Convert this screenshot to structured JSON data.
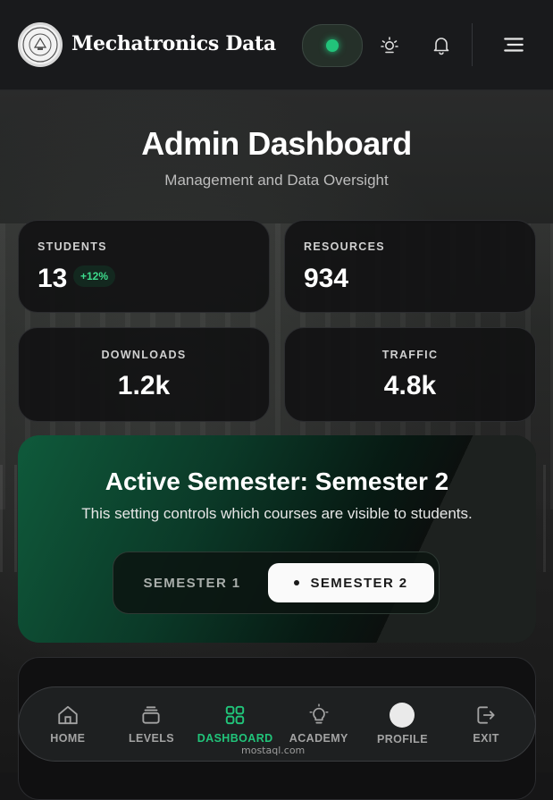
{
  "header": {
    "brand": "Mechatronics Data",
    "icons": [
      "globe-icon",
      "sun-icon",
      "bell-icon",
      "menu-icon"
    ]
  },
  "page": {
    "title": "Admin Dashboard",
    "subtitle": "Management and Data Oversight"
  },
  "stats": [
    {
      "label": "STUDENTS",
      "value": "13",
      "trend": "+12%"
    },
    {
      "label": "RESOURCES",
      "value": "934"
    },
    {
      "label": "DOWNLOADS",
      "value": "1.2k"
    },
    {
      "label": "TRAFFIC",
      "value": "4.8k"
    }
  ],
  "semester": {
    "title": "Active Semester: Semester 2",
    "description": "This setting controls which courses are visible to students.",
    "options": [
      "SEMESTER 1",
      "SEMESTER 2"
    ],
    "selected": "SEMESTER 2"
  },
  "nav": {
    "items": [
      {
        "label": "HOME",
        "icon": "home-icon"
      },
      {
        "label": "LEVELS",
        "icon": "layers-icon"
      },
      {
        "label": "DASHBOARD",
        "icon": "grid-icon",
        "active": true
      },
      {
        "label": "ACADEMY",
        "icon": "lightbulb-icon"
      },
      {
        "label": "PROFILE",
        "icon": "avatar"
      },
      {
        "label": "EXIT",
        "icon": "logout-icon"
      }
    ]
  },
  "watermark": "mostaql.com",
  "colors": {
    "accent": "#21c47a",
    "background": "#161617",
    "card": "#121213"
  }
}
